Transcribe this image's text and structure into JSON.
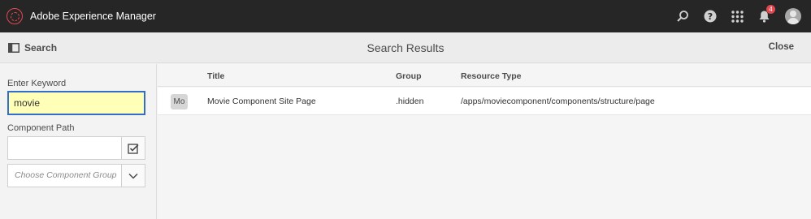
{
  "header": {
    "app_title": "Adobe Experience Manager",
    "notification_count": "4",
    "icons": [
      "aem-logo-icon",
      "search-icon",
      "help-icon",
      "apps-grid-icon",
      "bell-icon",
      "user-avatar-icon"
    ]
  },
  "toolbar": {
    "rail_label": "Search",
    "title": "Search Results",
    "close_label": "Close"
  },
  "sidepanel": {
    "keyword_label": "Enter Keyword",
    "keyword_value": "movie",
    "path_label": "Component Path",
    "path_value": "",
    "group_placeholder": "Choose Component Group"
  },
  "table": {
    "columns": [
      "Title",
      "Group",
      "Resource Type"
    ],
    "rows": [
      {
        "thumb": "Mo",
        "title": "Movie Component Site Page",
        "group": ".hidden",
        "resource_type": "/apps/moviecomponent/components/structure/page"
      }
    ]
  },
  "colors": {
    "topbar": "#262626",
    "accent_red": "#e34850",
    "focus_blue": "#326ec8",
    "input_highlight": "#ffffb8"
  }
}
